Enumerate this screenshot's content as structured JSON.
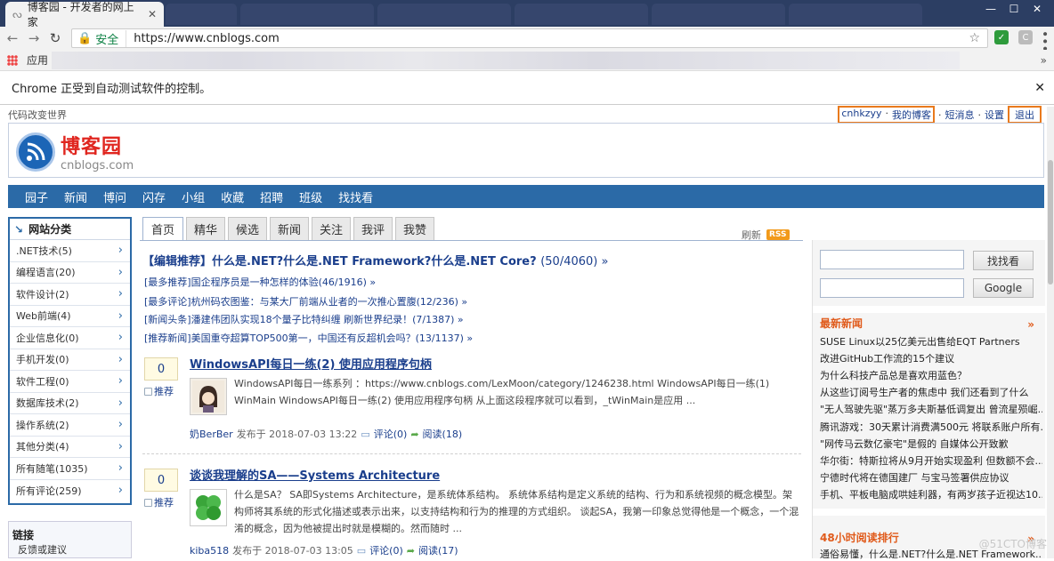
{
  "browser": {
    "tab_title": "博客园 - 开发者的网上家",
    "secure_label": "安全",
    "url": "https://www.cnblogs.com",
    "apps_label": "应用",
    "automation_notice": "Chrome 正受到自动测试软件的控制。"
  },
  "page": {
    "slogan": "代码改变世界",
    "user": {
      "name": "cnhkzyy",
      "my_blog": "我的博客",
      "messages": "短消息",
      "settings": "设置",
      "logout": "退出"
    },
    "logo": {
      "title": "博客园",
      "subtitle": "cnblogs.com"
    },
    "nav": [
      "园子",
      "新闻",
      "博问",
      "闪存",
      "小组",
      "收藏",
      "招聘",
      "班级",
      "找找看"
    ],
    "categories": {
      "title": "网站分类",
      "items": [
        ".NET技术(5)",
        "编程语言(20)",
        "软件设计(2)",
        "Web前端(4)",
        "企业信息化(0)",
        "手机开发(0)",
        "软件工程(0)",
        "数据库技术(2)",
        "操作系统(2)",
        "其他分类(4)",
        "所有随笔(1035)",
        "所有评论(259)"
      ]
    },
    "links": {
      "title": "链接",
      "item": "反馈或建议"
    },
    "tabs": [
      "首页",
      "精华",
      "候选",
      "新闻",
      "关注",
      "我评",
      "我赞"
    ],
    "refresh": "刷新",
    "rss": "RSS",
    "editor_pick": {
      "title": "【编辑推荐】什么是.NET?什么是.NET Framework?什么是.NET Core?",
      "count": "(50/4060) »"
    },
    "headlines": [
      "[最多推荐]国企程序员是一种怎样的体验(46/1916) »",
      "[最多评论]杭州码农图鉴：与某大厂前端从业者的一次推心置腹(12/236) »",
      "[新闻头条]潘建伟团队实现18个量子比特纠缠 刷新世界纪录！(7/1387) »",
      "[推荐新闻]美国重夺超算TOP500第一，中国还有反超机会吗？(13/1137) »"
    ],
    "posts": [
      {
        "votes": "0",
        "recommend": "推荐",
        "title": "WindowsAPI每日一练(2) 使用应用程序句柄",
        "summary": "WindowsAPI每日一练系列 ：https://www.cnblogs.com/LexMoon/category/1246238.html WindowsAPI每日一练(1) WinMain WindowsAPI每日一练(2) 使用应用程序句柄 从上面这段程序就可以看到，_tWinMain是应用 ...",
        "author": "奶BerBer",
        "posted": "发布于 2018-07-03 13:22",
        "comments": "评论(0)",
        "reads": "阅读(18)"
      },
      {
        "votes": "0",
        "recommend": "推荐",
        "title": "谈谈我理解的SA——Systems Architecture",
        "summary": "什么是SA？ SA即Systems Architecture，是系统体系结构。 系统体系结构是定义系统的结构、行为和系统视频的概念模型。架构师将其系统的形式化描述或表示出来，以支持结构和行为的推理的方式组织。 谈起SA，我第一印象总觉得他是一个概念，一个混淆的概念，因为他被提出时就是模糊的。然而随时 ...",
        "author": "kiba518",
        "posted": "发布于 2018-07-03 13:05",
        "comments": "评论(0)",
        "reads": "阅读(17)"
      }
    ],
    "search": {
      "button1": "找找看",
      "button2": "Google"
    },
    "latest_news": {
      "title": "最新新闻",
      "more": "»",
      "items": [
        "SUSE Linux以25亿美元出售给EQT Partners",
        "改进GitHub工作流的15个建议",
        "为什么科技产品总是喜欢用蓝色？",
        "从这些订阅号生产者的焦虑中 我们还看到了什么",
        "\"无人驾驶先驱\"蒸万多夫斯基低调复出 曾流星殒崛...",
        "腾讯游戏：30天累计消费满500元 将联系账户所有...",
        "\"网传马云数亿豪宅\"是假的 自媒体公开致歉",
        "华尔街：特斯拉将从9月开始实现盈利 但数额不会...",
        "宁德时代将在德国建厂 与宝马签署供应协议",
        "手机、平板电脑成哄娃利器，有两岁孩子近视达10..."
      ]
    },
    "hot_reads": {
      "title": "48小时阅读排行",
      "more": "»",
      "first": "通俗易懂，什么是.NET?什么是.NET Framework..."
    },
    "watermark": "@51CTO博客"
  }
}
